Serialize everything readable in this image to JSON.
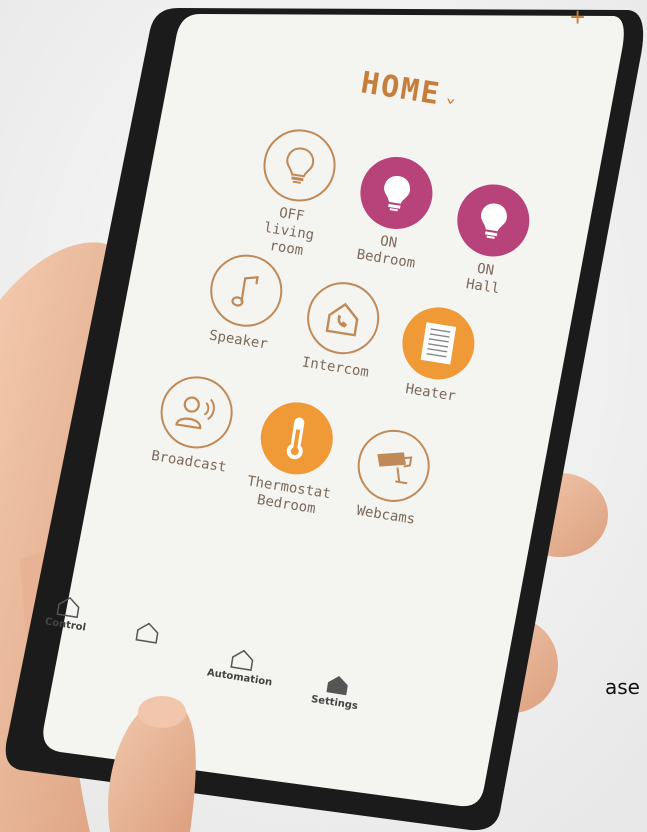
{
  "header": {
    "title": "HOME",
    "plus": "+"
  },
  "tiles": [
    {
      "status": "OFF",
      "label": "living room",
      "icon": "bulb-icon",
      "style": "outline"
    },
    {
      "status": "ON",
      "label": "Bedroom",
      "icon": "bulb-icon",
      "style": "pink"
    },
    {
      "status": "ON",
      "label": "Hall",
      "icon": "bulb-icon",
      "style": "pink"
    },
    {
      "label": "Speaker",
      "icon": "music-note-icon",
      "style": "outline"
    },
    {
      "label": "Intercom",
      "icon": "intercom-icon",
      "style": "outline"
    },
    {
      "label": "Heater",
      "icon": "heater-icon",
      "style": "orange"
    },
    {
      "label": "Broadcast",
      "icon": "broadcast-icon",
      "style": "outline"
    },
    {
      "label": "Thermostat",
      "sublabel": "Bedroom",
      "icon": "thermometer-icon",
      "style": "orange"
    },
    {
      "label": "Webcams",
      "icon": "camera-icon",
      "style": "outline"
    }
  ],
  "bottom_nav": [
    {
      "label": "Control",
      "icon": "home-icon"
    },
    {
      "label": "",
      "icon": "home-icon"
    },
    {
      "label": "Automation",
      "icon": "home-icon"
    },
    {
      "label": "Settings",
      "icon": "home-filled-icon"
    }
  ],
  "edge_text": "ase",
  "colors": {
    "accent": "#c67e3a",
    "pink": "#b8437a",
    "orange": "#ef9a37",
    "outline": "#c08a58"
  }
}
